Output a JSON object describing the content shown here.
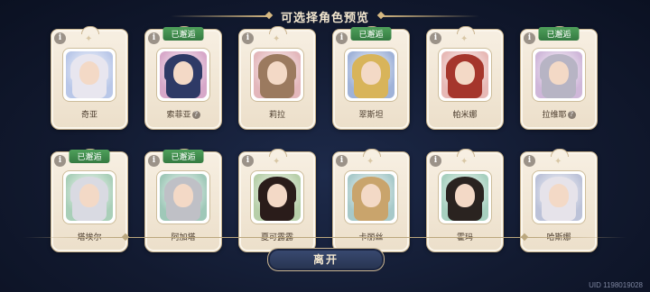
{
  "title": "可选择角色预览",
  "info_glyph": "i",
  "characters": [
    {
      "name": "奇亚",
      "badge": "",
      "has_question": false,
      "hair_color": "#e8e6ef",
      "bg": "#b9c7e8"
    },
    {
      "name": "索菲亚",
      "badge": "已邂逅",
      "has_question": true,
      "hair_color": "#2e3a66",
      "bg": "#d7a8c9"
    },
    {
      "name": "莉拉",
      "badge": "",
      "has_question": false,
      "hair_color": "#9b7a5f",
      "bg": "#e3b7bb"
    },
    {
      "name": "翠斯坦",
      "badge": "已邂逅",
      "has_question": false,
      "hair_color": "#d8b45a",
      "bg": "#9fb2d8"
    },
    {
      "name": "帕米娜",
      "badge": "",
      "has_question": false,
      "hair_color": "#a5362c",
      "bg": "#e7b9b6"
    },
    {
      "name": "拉维耶",
      "badge": "已邂逅",
      "has_question": true,
      "hair_color": "#b7b4c4",
      "bg": "#cfb7d9"
    },
    {
      "name": "塔埃尔",
      "badge": "已邂逅",
      "has_question": false,
      "hair_color": "#d9dae2",
      "bg": "#a9cfb8"
    },
    {
      "name": "阿加塔",
      "badge": "已邂逅",
      "has_question": false,
      "hair_color": "#bfc0c6",
      "bg": "#9fc8b8"
    },
    {
      "name": "夏可露露",
      "badge": "",
      "has_question": false,
      "hair_color": "#2a1c1a",
      "bg": "#b7cfa9"
    },
    {
      "name": "卡丽丝",
      "badge": "",
      "has_question": false,
      "hair_color": "#c9a46c",
      "bg": "#a7c9c9"
    },
    {
      "name": "霍玛",
      "badge": "",
      "has_question": false,
      "hair_color": "#2a2320",
      "bg": "#a7d0bf"
    },
    {
      "name": "哈斯娜",
      "badge": "",
      "has_question": false,
      "hair_color": "#e6e3ea",
      "bg": "#bcc2d8"
    }
  ],
  "question_glyph": "?",
  "leave_button": "离开",
  "uid": "UID 1198019028"
}
